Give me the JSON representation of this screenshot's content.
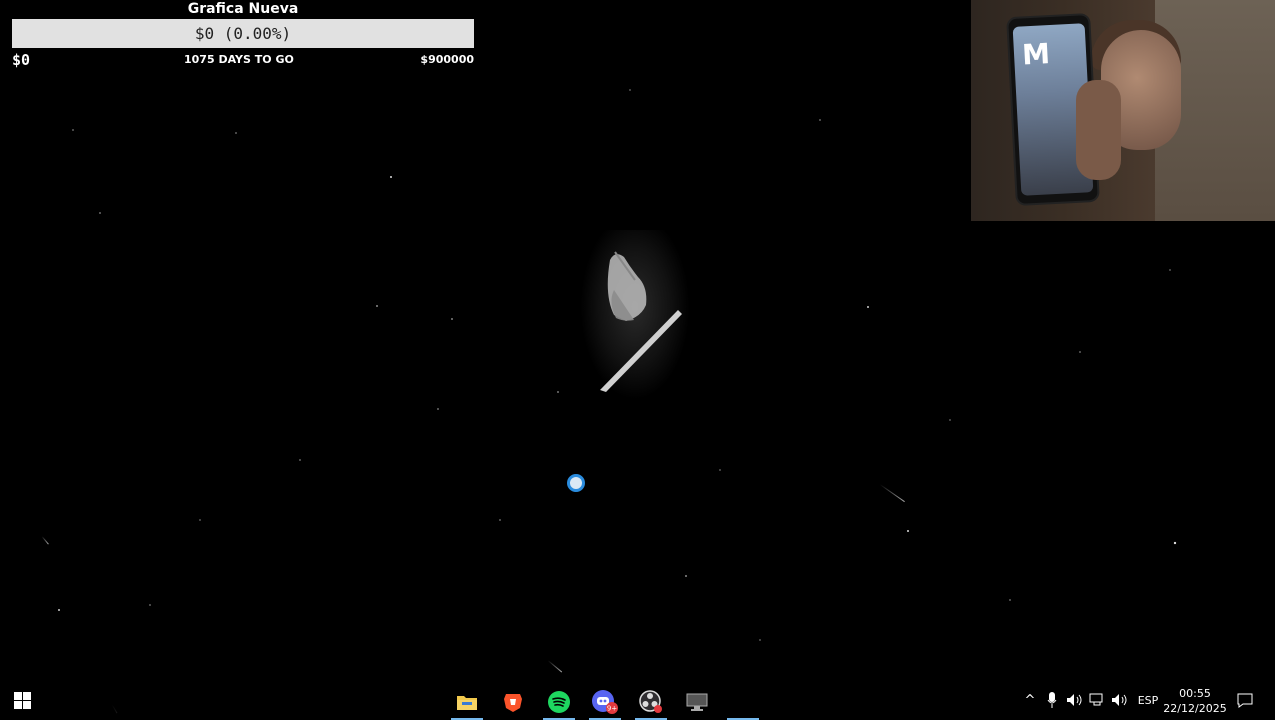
{
  "goal_widget": {
    "title": "Grafica Nueva",
    "bar_text": "$0 (0.00%)",
    "progress_fraction": 0.0,
    "start_value": "$0",
    "days_left": "1075 DAYS TO GO",
    "target_value": "$900000",
    "fill_color": "#6abf4b",
    "bar_color": "#e1e1e1"
  },
  "webcam": {
    "phone_screen_text": "M"
  },
  "taskbar": {
    "apps": [
      {
        "name": "file-explorer",
        "icon": "folder-icon"
      },
      {
        "name": "brave",
        "icon": "brave-lion-icon"
      },
      {
        "name": "spotify",
        "icon": "spotify-icon"
      },
      {
        "name": "discord",
        "icon": "discord-icon",
        "badge": "9+"
      },
      {
        "name": "obs-studio",
        "icon": "obs-icon"
      },
      {
        "name": "monitor-app",
        "icon": "monitor-icon"
      }
    ],
    "tray": {
      "language": "ESP",
      "time": "00:55",
      "date": "22/12/2025"
    }
  },
  "colors": {
    "accent_underline": "#76b9ed",
    "cursor": "#2a8cde"
  }
}
